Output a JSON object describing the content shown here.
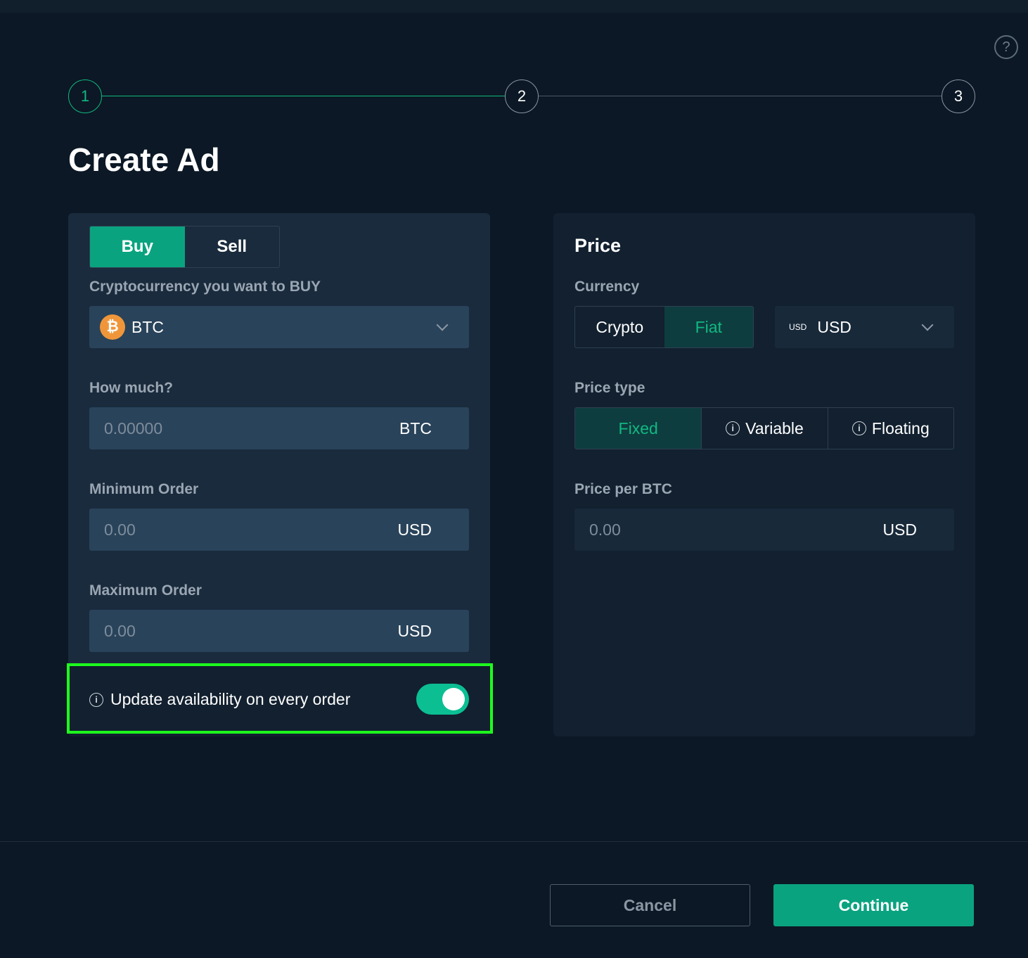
{
  "help": {
    "glyph": "?"
  },
  "stepper": {
    "steps": [
      "1",
      "2",
      "3"
    ],
    "active_step": "1"
  },
  "page": {
    "title": "Create Ad"
  },
  "trade": {
    "buy_label": "Buy",
    "sell_label": "Sell",
    "selected": "Buy",
    "crypto_label": "Cryptocurrency you want to BUY",
    "crypto_value": "BTC",
    "crypto_icon": "bitcoin-icon",
    "how_much_label": "How much?",
    "how_much_placeholder": "0.00000",
    "how_much_unit": "BTC",
    "min_label": "Minimum Order",
    "min_placeholder": "0.00",
    "min_unit": "USD",
    "max_label": "Maximum Order",
    "max_placeholder": "0.00",
    "max_unit": "USD",
    "update_label": "Update availability on every order",
    "update_on": true
  },
  "price": {
    "title": "Price",
    "currency_label": "Currency",
    "crypto_label": "Crypto",
    "fiat_label": "Fiat",
    "currency_selected": "Fiat",
    "fiat_small": "USD",
    "fiat_value": "USD",
    "price_type_label": "Price type",
    "fixed_label": "Fixed",
    "variable_label": "Variable",
    "floating_label": "Floating",
    "price_type_selected": "Fixed",
    "per_label": "Price per BTC",
    "per_placeholder": "0.00",
    "per_unit": "USD"
  },
  "footer": {
    "cancel_label": "Cancel",
    "continue_label": "Continue"
  },
  "colors": {
    "accent": "#0aa380",
    "background": "#0c1825",
    "panel": "#1a2b3d",
    "highlight": "#1dff1d"
  }
}
